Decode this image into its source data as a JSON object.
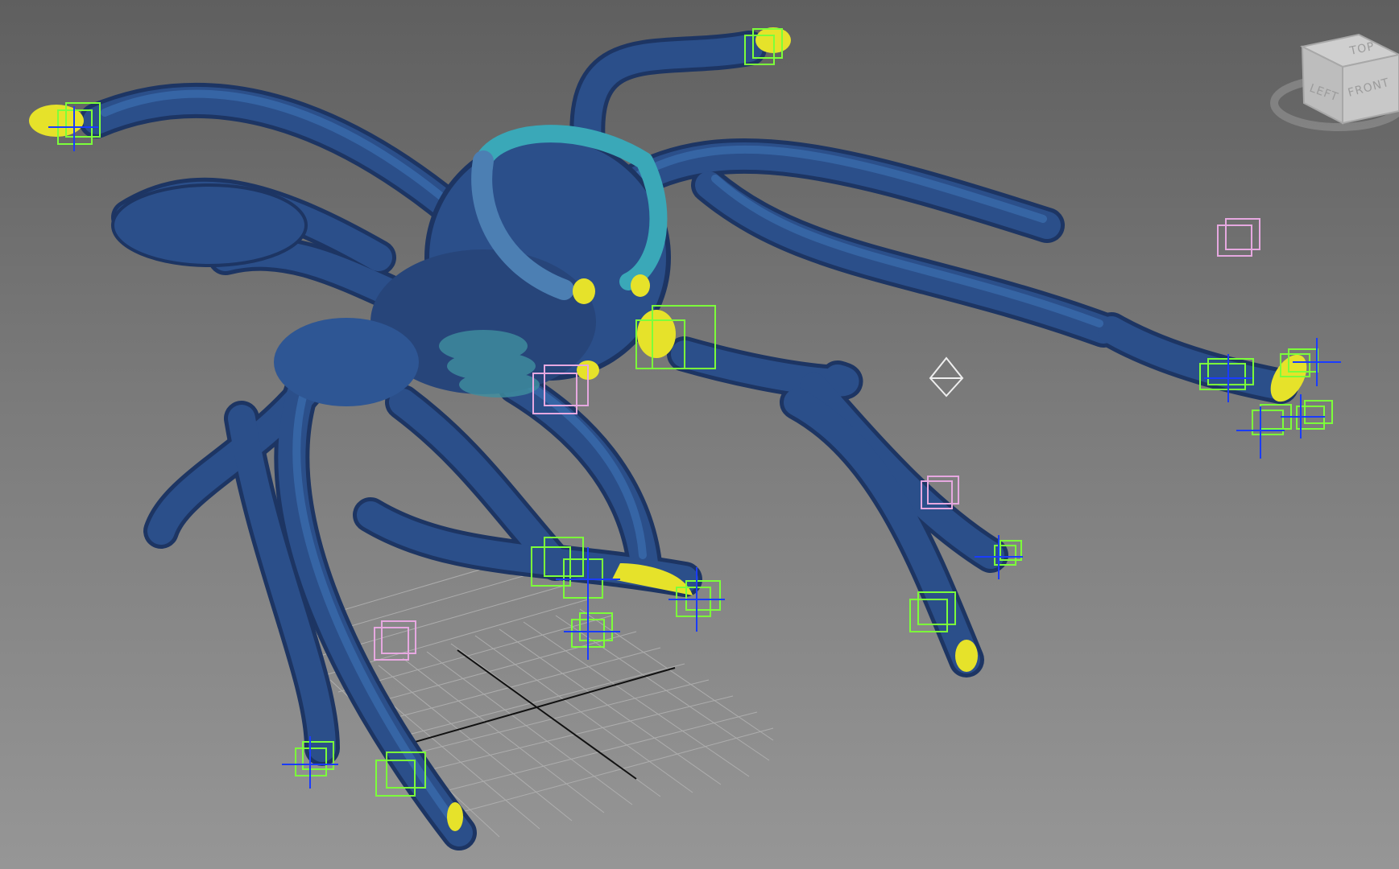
{
  "viewport": {
    "colors": {
      "background_top": "#5f5f5f",
      "background_bottom": "#969696",
      "creature_body": "#2b4f8a",
      "creature_highlight": "#3c6fb0",
      "tentacle_tip": "#e6e22a",
      "helper_box_selected": "#7cff3a",
      "helper_box_unselected": "#e6a8e0",
      "gizmo_axis": "#1a3cff",
      "grid": "#b3b3b3"
    },
    "objects": [
      "creature-mesh",
      "ik-helper-boxes",
      "dummy-helpers",
      "home-grid",
      "light-target"
    ]
  },
  "viewcube": {
    "top_label": "TOP",
    "left_label": "LEFT",
    "front_label": "FRONT"
  }
}
